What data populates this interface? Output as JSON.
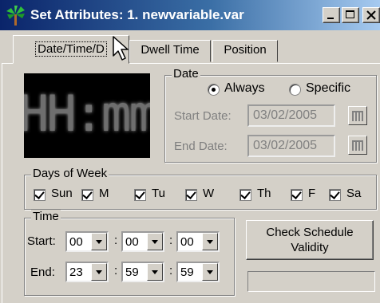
{
  "window": {
    "title": "Set Attributes: 1. newvariable.var",
    "icon": "palm-tree-icon"
  },
  "tabs": [
    {
      "label": "Date/Time/D"
    },
    {
      "label": "Dwell Time"
    },
    {
      "label": "Position"
    }
  ],
  "preview": {
    "text": "HH:mm"
  },
  "date_group": {
    "label": "Date",
    "always_label": "Always",
    "specific_label": "Specific",
    "selected": "Always",
    "start_label": "Start Date:",
    "start_value": "03/02/2005",
    "end_label": "End Date:",
    "end_value": "03/02/2005"
  },
  "days_group": {
    "label": "Days of Week",
    "days": [
      {
        "label": "Sun",
        "checked": true
      },
      {
        "label": "M",
        "checked": true
      },
      {
        "label": "Tu",
        "checked": true
      },
      {
        "label": "W",
        "checked": true
      },
      {
        "label": "Th",
        "checked": true
      },
      {
        "label": "F",
        "checked": true
      },
      {
        "label": "Sa",
        "checked": true
      }
    ]
  },
  "time_group": {
    "label": "Time",
    "start_label": "Start:",
    "end_label": "End:",
    "separator": ":",
    "start": [
      "00",
      "00",
      "00"
    ],
    "end": [
      "23",
      "59",
      "59"
    ]
  },
  "check_button": {
    "line1": "Check Schedule",
    "line2": "Validity"
  }
}
